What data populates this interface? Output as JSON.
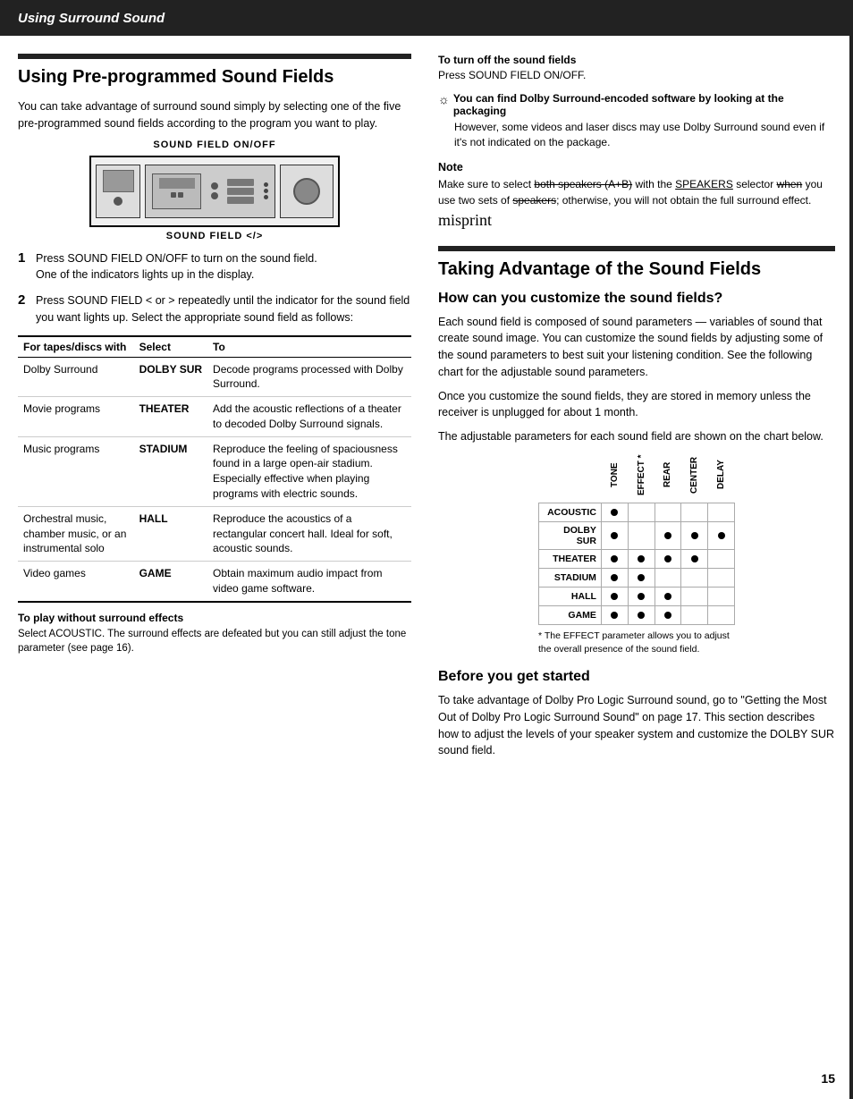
{
  "header": {
    "title": "Using Surround Sound"
  },
  "left_section": {
    "title": "Using Pre-programmed Sound Fields",
    "intro": "You can take advantage of surround sound simply by selecting one of the five pre-programmed sound fields according to the program you want to play.",
    "sound_field_label_top": "SOUND FIELD ON/OFF",
    "sound_field_label_bottom": "SOUND FIELD </>",
    "steps": [
      {
        "number": "1",
        "text": "Press SOUND FIELD ON/OFF to turn on the sound field.\nOne of the indicators lights up in the display."
      },
      {
        "number": "2",
        "text": "Press SOUND FIELD < or > repeatedly until the indicator for the sound field you want lights up. Select the appropriate sound field as follows:"
      }
    ],
    "table": {
      "headers": [
        "For tapes/discs with",
        "Select",
        "To"
      ],
      "rows": [
        {
          "for": "Dolby Surround",
          "select": "DOLBY SUR",
          "to": "Decode programs processed with Dolby Surround."
        },
        {
          "for": "Movie programs",
          "select": "THEATER",
          "to": "Add the acoustic reflections of a theater to decoded Dolby Surround signals."
        },
        {
          "for": "Music programs",
          "select": "STADIUM",
          "to": "Reproduce the feeling of spaciousness found in a large open-air stadium. Especially effective when playing programs with electric sounds."
        },
        {
          "for": "Orchestral music, chamber music, or an instrumental solo",
          "select": "HALL",
          "to": "Reproduce the acoustics of a rectangular concert hall. Ideal for soft, acoustic sounds."
        },
        {
          "for": "Video games",
          "select": "GAME",
          "to": "Obtain maximum audio impact from video game software."
        }
      ]
    },
    "to_play_label": "To play without surround effects",
    "to_play_text": "Select ACOUSTIC. The surround effects are defeated but you can still adjust the tone parameter (see page 16)."
  },
  "right_section": {
    "turn_off_label": "To turn off the sound fields",
    "turn_off_text": "Press SOUND FIELD ON/OFF.",
    "tip_title": "You can find Dolby Surround-encoded software by looking at the packaging",
    "tip_text": "However, some videos and laser discs may use Dolby Surround sound even if it's not indicated on the package.",
    "note_header": "Note",
    "note_text_pre": "Make sure to select both speakers (A+B) with the SPEAKERS selector when you use two sets of speakers; otherwise, you will not obtain the full surround effect.",
    "note_misprint": "misprint",
    "section2_title": "Taking Advantage of the Sound Fields",
    "how_title": "How can you customize the sound fields?",
    "how_text1": "Each sound field is composed of sound parameters — variables of sound that create sound image. You can customize the sound fields by adjusting some of the sound parameters to best suit your listening condition. See the following chart for the adjustable sound parameters.",
    "how_text2": "Once you customize the sound fields, they are stored in memory unless the receiver is unplugged for about 1 month.",
    "how_text3": "The adjustable parameters for each sound field are shown on the chart below.",
    "chart": {
      "col_headers": [
        "TONE",
        "EFFECT*",
        "REAR",
        "CENTER",
        "DELAY"
      ],
      "rows": [
        {
          "label": "ACOUSTIC",
          "tone": true,
          "effect": false,
          "rear": false,
          "center": false,
          "delay": false
        },
        {
          "label": "DOLBY SUR",
          "tone": true,
          "effect": false,
          "rear": true,
          "center": true,
          "delay": true
        },
        {
          "label": "THEATER",
          "tone": true,
          "effect": true,
          "rear": true,
          "center": true,
          "delay": false
        },
        {
          "label": "STADIUM",
          "tone": true,
          "effect": true,
          "rear": false,
          "center": false,
          "delay": false
        },
        {
          "label": "HALL",
          "tone": true,
          "effect": true,
          "rear": true,
          "center": false,
          "delay": false
        },
        {
          "label": "GAME",
          "tone": true,
          "effect": true,
          "rear": true,
          "center": false,
          "delay": false
        }
      ],
      "footnote": "* The EFFECT parameter allows you to adjust the overall presence of the sound field."
    },
    "before_title": "Before you get started",
    "before_text": "To take advantage of Dolby Pro Logic Surround sound, go to \"Getting the Most Out of Dolby Pro Logic Surround Sound\" on page 17. This section describes how to adjust the levels of your speaker system and customize the DOLBY SUR sound field."
  },
  "page_number": "15"
}
